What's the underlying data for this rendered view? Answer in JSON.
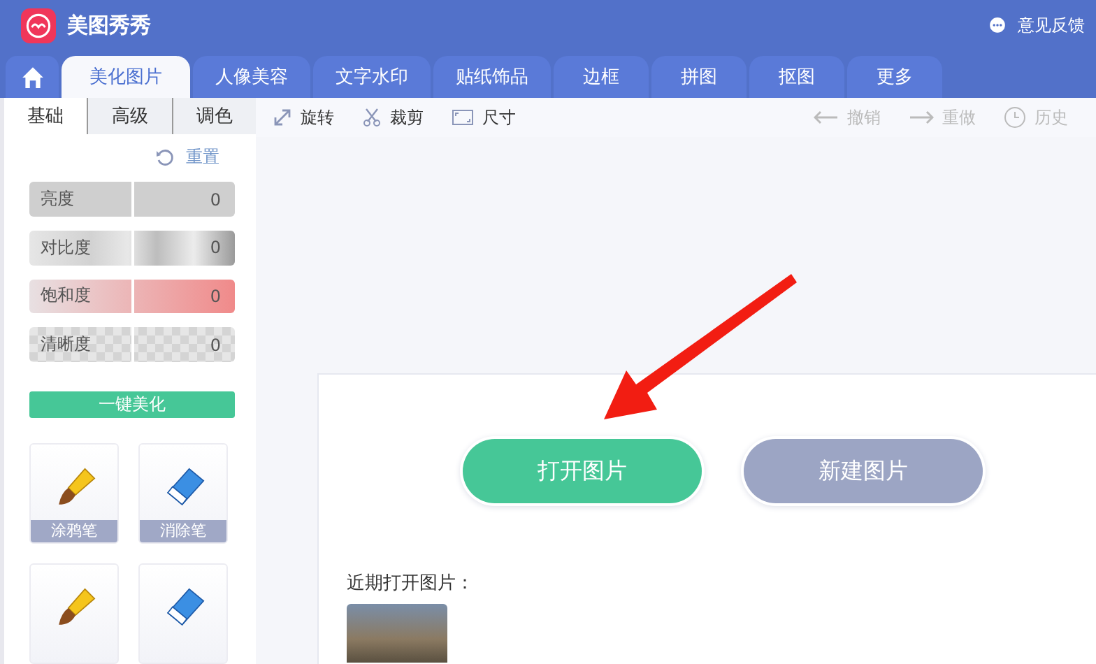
{
  "app": {
    "title": "美图秀秀",
    "feedback": "意见反馈"
  },
  "tabs": [
    {
      "label": "美化图片",
      "selected": true
    },
    {
      "label": "人像美容",
      "selected": false
    },
    {
      "label": "文字水印",
      "selected": false
    },
    {
      "label": "贴纸饰品",
      "selected": false
    },
    {
      "label": "边框",
      "selected": false
    },
    {
      "label": "拼图",
      "selected": false
    },
    {
      "label": "抠图",
      "selected": false
    },
    {
      "label": "更多",
      "selected": false
    }
  ],
  "panel_tabs": [
    {
      "label": "基础",
      "selected": true
    },
    {
      "label": "高级",
      "selected": false
    },
    {
      "label": "调色",
      "selected": false
    }
  ],
  "reset": "重置",
  "adjustments": [
    {
      "kind": "brightness",
      "label": "亮度",
      "reading": "0",
      "level": 0.5
    },
    {
      "kind": "contrast",
      "label": "对比度",
      "reading": "0",
      "level": 0.5
    },
    {
      "kind": "saturation",
      "label": "饱和度",
      "reading": "0",
      "level": 0.5
    },
    {
      "kind": "clarity",
      "label": "清晰度",
      "reading": "0",
      "level": 0.5
    }
  ],
  "auto_button": "一键美化",
  "tools": [
    {
      "kind": "brush",
      "label": "涂鸦笔"
    },
    {
      "kind": "eraser",
      "label": "消除笔"
    },
    {
      "kind": "pencil"
    },
    {
      "kind": "blue-eraser"
    }
  ],
  "toolbar": [
    {
      "kind": "rotate",
      "label": "旋转",
      "disabled": false
    },
    {
      "kind": "crop",
      "label": "裁剪",
      "disabled": false
    },
    {
      "kind": "size",
      "label": "尺寸",
      "disabled": false
    }
  ],
  "history_bar": [
    {
      "kind": "undo",
      "label": "撤销",
      "disabled": true
    },
    {
      "kind": "redo",
      "label": "重做",
      "disabled": true
    },
    {
      "kind": "history",
      "label": "历史",
      "disabled": true
    }
  ],
  "start": {
    "open_button": "打开图片",
    "new_button": "新建图片",
    "recent_label": "近期打开图片："
  }
}
